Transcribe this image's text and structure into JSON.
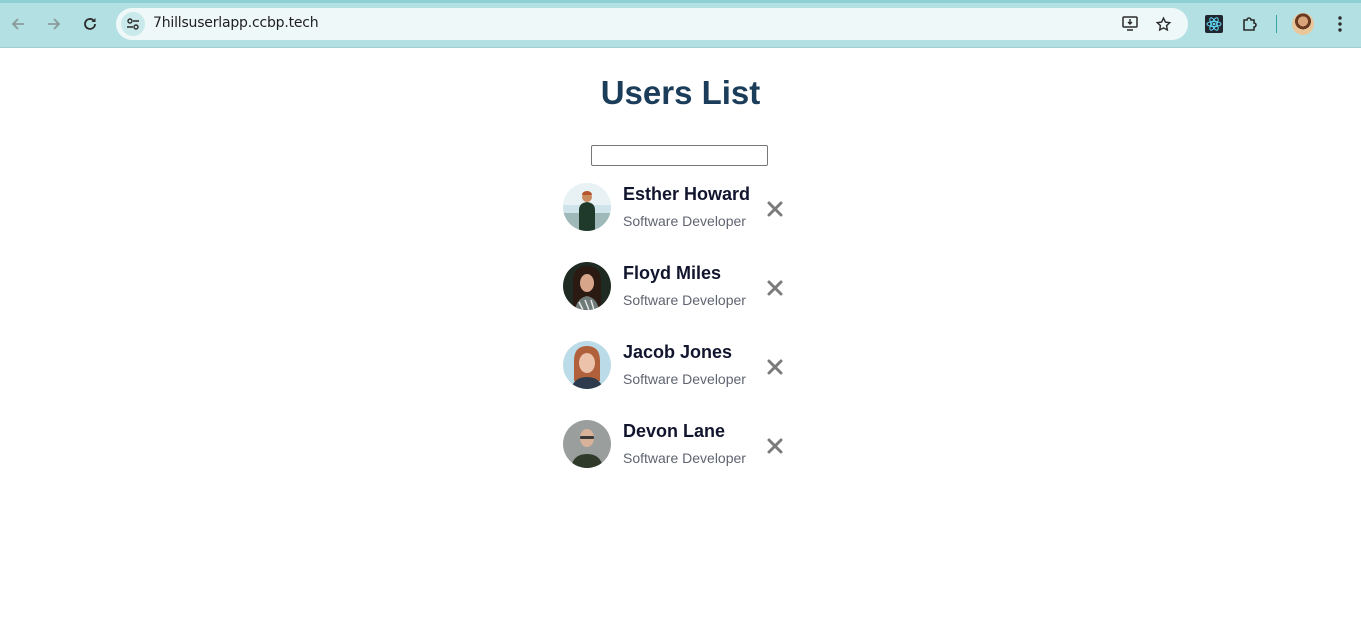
{
  "browser": {
    "url": "7hillsuserlapp.ccbp.tech"
  },
  "page": {
    "title": "Users List",
    "search": {
      "value": "",
      "placeholder": ""
    }
  },
  "users": [
    {
      "name": "Esther Howard",
      "role": "Software Developer"
    },
    {
      "name": "Floyd Miles",
      "role": "Software Developer"
    },
    {
      "name": "Jacob Jones",
      "role": "Software Developer"
    },
    {
      "name": "Devon Lane",
      "role": "Software Developer"
    }
  ],
  "colors": {
    "title": "#1b3d59",
    "name": "#12152e",
    "role": "#5f6470",
    "delete_icon": "#7b7b7b",
    "browser_frame": "#b3e0e2"
  },
  "icons": {
    "back": "arrow-left-icon",
    "forward": "arrow-right-icon",
    "reload": "reload-icon",
    "site_info": "tune-icon",
    "install": "install-app-icon",
    "bookmark": "star-icon",
    "react_devtools": "react-icon",
    "extensions": "puzzle-icon",
    "menu": "kebab-menu-icon",
    "delete": "close-icon"
  }
}
